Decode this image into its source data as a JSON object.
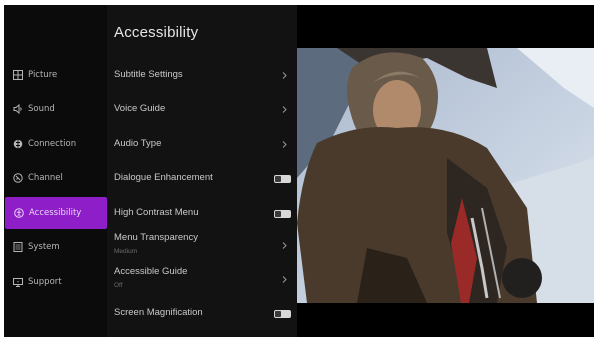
{
  "sidebar": {
    "items": [
      {
        "label": "Picture",
        "icon": "picture-icon"
      },
      {
        "label": "Sound",
        "icon": "speaker-icon"
      },
      {
        "label": "Connection",
        "icon": "globe-icon"
      },
      {
        "label": "Channel",
        "icon": "satellite-dish-icon"
      },
      {
        "label": "Accessibility",
        "icon": "accessibility-icon",
        "active": true
      },
      {
        "label": "System",
        "icon": "system-icon"
      },
      {
        "label": "Support",
        "icon": "support-icon"
      }
    ]
  },
  "panel": {
    "title": "Accessibility",
    "rows": [
      {
        "label": "Subtitle Settings",
        "control": "chevron"
      },
      {
        "label": "Voice Guide",
        "control": "chevron"
      },
      {
        "label": "Audio Type",
        "control": "chevron"
      },
      {
        "label": "Dialogue Enhancement",
        "control": "toggle"
      },
      {
        "label": "High Contrast Menu",
        "control": "toggle"
      },
      {
        "label": "Menu Transparency",
        "sub": "Medium",
        "control": "chevron"
      },
      {
        "label": "Accessible Guide",
        "sub": "Off",
        "control": "chevron"
      },
      {
        "label": "Screen Magnification",
        "control": "toggle"
      }
    ]
  },
  "colors": {
    "accent": "#8e1fc8",
    "sidebar_bg": "#0b0b0b",
    "panel_bg": "#121212"
  }
}
